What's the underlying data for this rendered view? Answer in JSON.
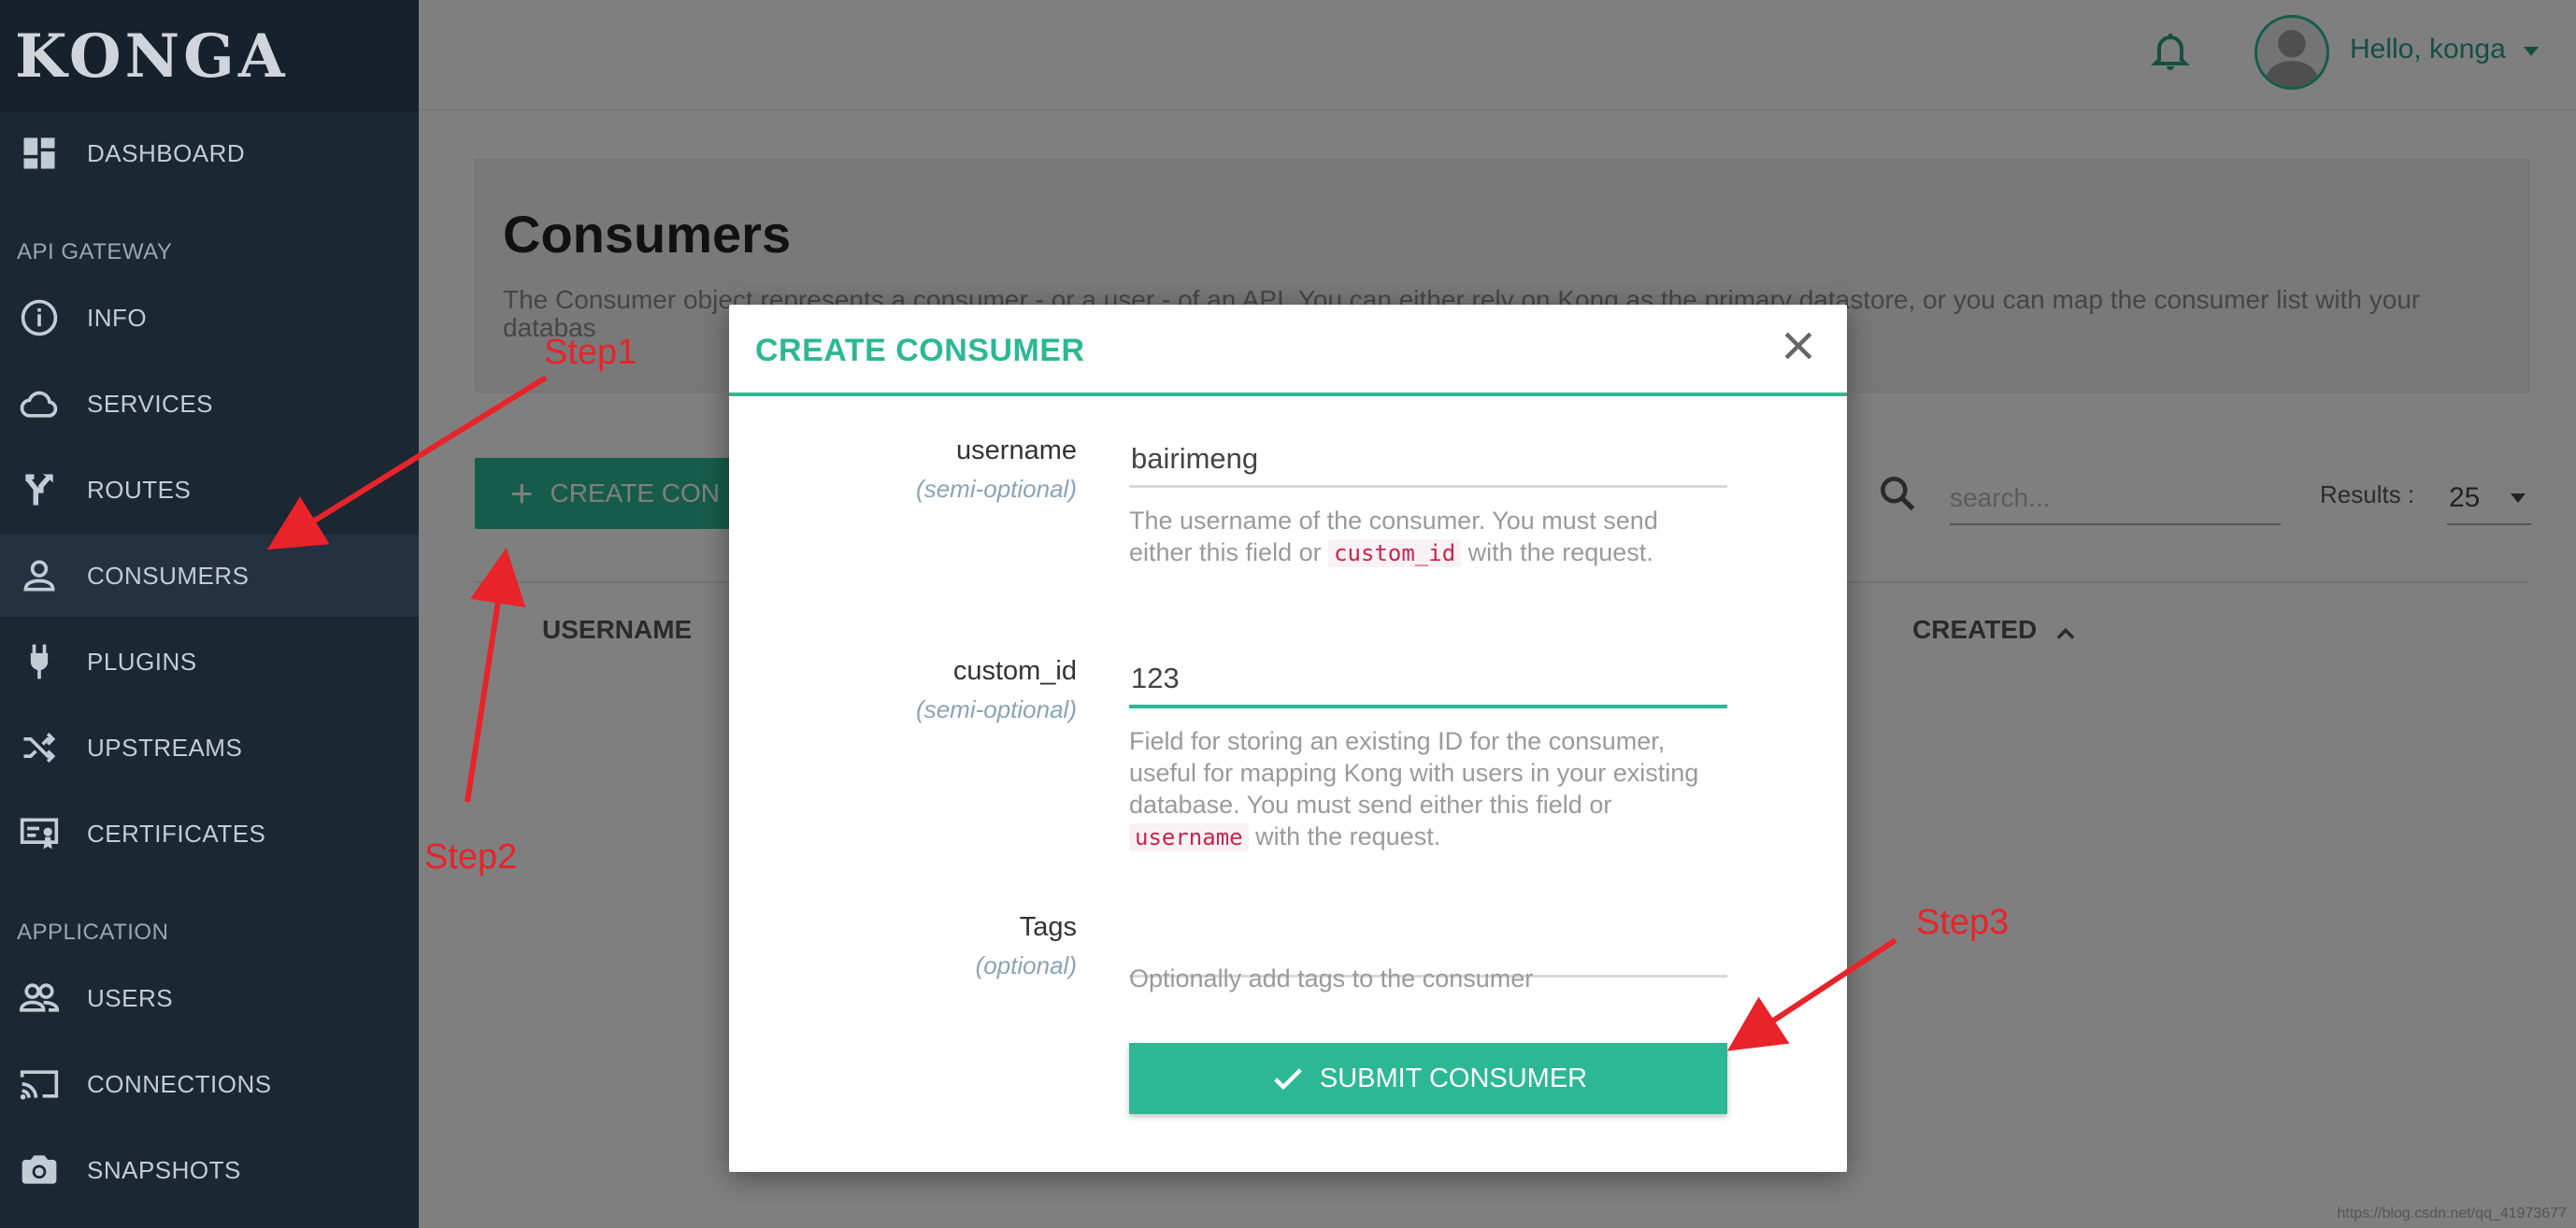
{
  "app": {
    "brand": "KONGA"
  },
  "sidebar": {
    "items": [
      {
        "label": "DASHBOARD",
        "icon": "dashboard-icon"
      },
      {
        "label": "INFO",
        "icon": "info-icon"
      },
      {
        "label": "SERVICES",
        "icon": "cloud-icon"
      },
      {
        "label": "ROUTES",
        "icon": "routes-icon"
      },
      {
        "label": "CONSUMERS",
        "icon": "user-icon"
      },
      {
        "label": "PLUGINS",
        "icon": "plug-icon"
      },
      {
        "label": "UPSTREAMS",
        "icon": "shuffle-icon"
      },
      {
        "label": "CERTIFICATES",
        "icon": "certificate-icon"
      },
      {
        "label": "USERS",
        "icon": "users-icon"
      },
      {
        "label": "CONNECTIONS",
        "icon": "cast-icon"
      },
      {
        "label": "SNAPSHOTS",
        "icon": "camera-icon"
      }
    ],
    "sections": {
      "api_gateway": "API GATEWAY",
      "application": "APPLICATION"
    }
  },
  "topbar": {
    "greeting": "Hello, konga"
  },
  "main": {
    "title": "Consumers",
    "description": "The Consumer object represents a consumer - or a user - of an API. You can either rely on Kong as the primary datastore, or you can map the consumer list with your databas",
    "create_button": "CREATE CON",
    "search_placeholder": "search...",
    "results_label": "Results :",
    "results_value": "25",
    "columns": {
      "username": "USERNAME",
      "created": "CREATED"
    }
  },
  "modal": {
    "title": "CREATE CONSUMER",
    "fields": {
      "username": {
        "label": "username",
        "sub": "(semi-optional)",
        "value": "bairimeng",
        "help_pre": "The username of the consumer. You must send either this field or ",
        "help_code": "custom_id",
        "help_post": " with the request."
      },
      "custom_id": {
        "label": "custom_id",
        "sub": "(semi-optional)",
        "value": "123",
        "help_pre": "Field for storing an existing ID for the consumer, useful for mapping Kong with users in your existing database. You must send either this field or ",
        "help_code": "username",
        "help_post": " with the request."
      },
      "tags": {
        "label": "Tags",
        "sub": "(optional)",
        "value": "",
        "help": "Optionally add tags to the consumer"
      }
    },
    "submit_label": "SUBMIT CONSUMER"
  },
  "annotations": {
    "step1": "Step1",
    "step2": "Step2",
    "step3": "Step3"
  },
  "footer": {
    "watermark": "https://blog.csdn.net/qq_41973677"
  },
  "colors": {
    "accent": "#2cb894",
    "sidebar": "#1b2733",
    "annotation": "#e8232a"
  }
}
